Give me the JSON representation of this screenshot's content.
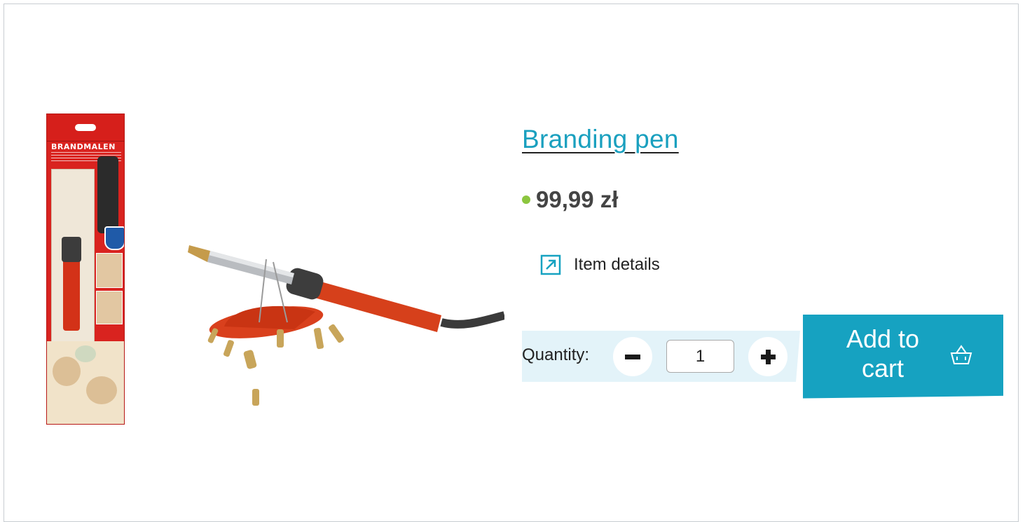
{
  "product": {
    "title": "Branding pen",
    "price": "99,99 zł",
    "availability_color": "#8cc63f",
    "details_label": "Item details",
    "details_icon": "external-link-arrow-icon",
    "image_alt": "Branding pen set with package and tips",
    "package_text": "BRANDMALEN"
  },
  "quantity": {
    "label": "Quantity:",
    "value": "1",
    "decrease_icon": "minus-icon",
    "increase_icon": "plus-icon"
  },
  "cart": {
    "button_label": "Add to cart",
    "icon": "basket-icon"
  },
  "colors": {
    "accent": "#16a2c1",
    "title": "#1aa0bf",
    "quantity_bg": "#e3f3f9"
  }
}
